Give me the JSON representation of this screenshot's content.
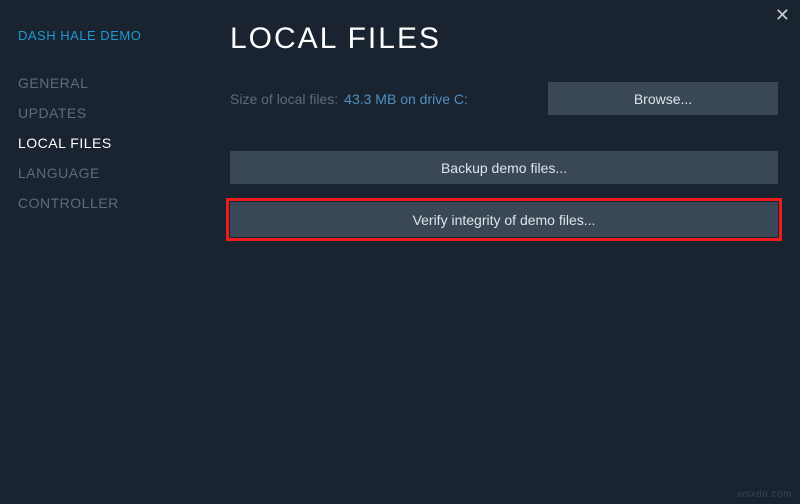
{
  "sidebar": {
    "app_title": "DASH HALE DEMO",
    "items": [
      {
        "label": "GENERAL"
      },
      {
        "label": "UPDATES"
      },
      {
        "label": "LOCAL FILES"
      },
      {
        "label": "LANGUAGE"
      },
      {
        "label": "CONTROLLER"
      }
    ]
  },
  "main": {
    "title": "LOCAL FILES",
    "size_label": "Size of local files:",
    "size_value": "43.3 MB on drive C:",
    "browse_label": "Browse...",
    "backup_label": "Backup demo files...",
    "verify_label": "Verify integrity of demo files..."
  },
  "close_glyph": "✕",
  "watermark": "wsxdn.com"
}
